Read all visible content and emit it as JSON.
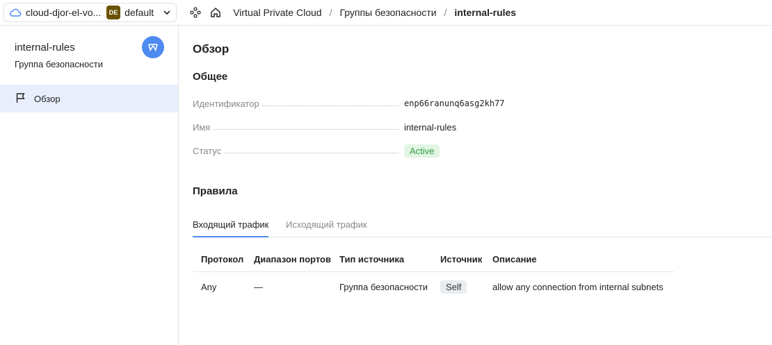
{
  "topbar": {
    "cloud_name": "cloud-djor-el-vo...",
    "folder_badge": "DE",
    "folder_name": "default",
    "breadcrumbs": [
      "Virtual Private Cloud",
      "Группы безопасности",
      "internal-rules"
    ],
    "separator": "/"
  },
  "sidebar": {
    "title": "internal-rules",
    "subtitle": "Группа безопасности",
    "nav_items": [
      {
        "label": "Обзор",
        "icon": "flag-icon",
        "active": true
      }
    ]
  },
  "main": {
    "page_title": "Обзор",
    "general_title": "Общее",
    "properties": [
      {
        "key": "Идентификатор",
        "value": "enp66ranunq6asg2kh77"
      },
      {
        "key": "Имя",
        "value": "internal-rules"
      },
      {
        "key": "Статус",
        "value": "Active"
      }
    ],
    "rules_title": "Правила",
    "tabs": [
      {
        "label": "Входящий трафик",
        "active": true
      },
      {
        "label": "Исходящий трафик",
        "active": false
      }
    ],
    "table": {
      "headers": [
        "Протокол",
        "Диапазон портов",
        "Тип источника",
        "Источник",
        "Описание"
      ],
      "rows": [
        [
          "Any",
          "—",
          "Группа безопасности",
          "Self",
          "allow any connection from internal subnets"
        ]
      ]
    }
  },
  "colors": {
    "accent": "#4e8af0",
    "status_active_bg": "#e2f5e4",
    "status_active_text": "#2f9d45",
    "folder_badge_bg": "#6a5200",
    "nav_active_bg": "#e8eefc"
  }
}
